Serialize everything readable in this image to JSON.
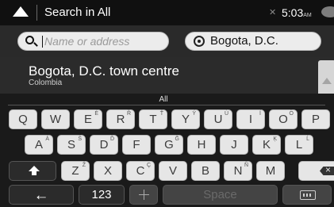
{
  "titlebar": {
    "title": "Search in All",
    "time": "5:03",
    "ampm": "AM",
    "icons": [
      "back-arrow-icon",
      "signal-off-icon",
      "chat-bubble-icon"
    ]
  },
  "search": {
    "placeholder": "Name or address",
    "value": "",
    "city": "Bogota, D.C."
  },
  "result": {
    "title": "Bogota, D.C. town centre",
    "subtitle": "Colombia"
  },
  "keyboard": {
    "label": "All",
    "row1": [
      {
        "ch": "Q",
        "sup": ""
      },
      {
        "ch": "W",
        "sup": ""
      },
      {
        "ch": "E",
        "sup": "É"
      },
      {
        "ch": "R",
        "sup": "Ř"
      },
      {
        "ch": "T",
        "sup": "Ť"
      },
      {
        "ch": "Y",
        "sup": "Ý"
      },
      {
        "ch": "U",
        "sup": "Ù"
      },
      {
        "ch": "I",
        "sup": "Í"
      },
      {
        "ch": "O",
        "sup": "Ö"
      },
      {
        "ch": "P",
        "sup": ""
      }
    ],
    "row2": [
      {
        "ch": "A",
        "sup": "Á"
      },
      {
        "ch": "S",
        "sup": "Š"
      },
      {
        "ch": "D",
        "sup": "Ď"
      },
      {
        "ch": "F",
        "sup": ""
      },
      {
        "ch": "G",
        "sup": "Ğ"
      },
      {
        "ch": "H",
        "sup": ""
      },
      {
        "ch": "J",
        "sup": ""
      },
      {
        "ch": "K",
        "sup": "Ķ"
      },
      {
        "ch": "L",
        "sup": "Ĺ"
      }
    ],
    "row3": [
      {
        "ch": "Z",
        "sup": "Ž"
      },
      {
        "ch": "X",
        "sup": ""
      },
      {
        "ch": "C",
        "sup": "Ç"
      },
      {
        "ch": "V",
        "sup": ""
      },
      {
        "ch": "B",
        "sup": ""
      },
      {
        "ch": "N",
        "sup": "Ñ"
      },
      {
        "ch": "M",
        "sup": ""
      }
    ],
    "numbers_label": "123",
    "space_label": "Space"
  }
}
